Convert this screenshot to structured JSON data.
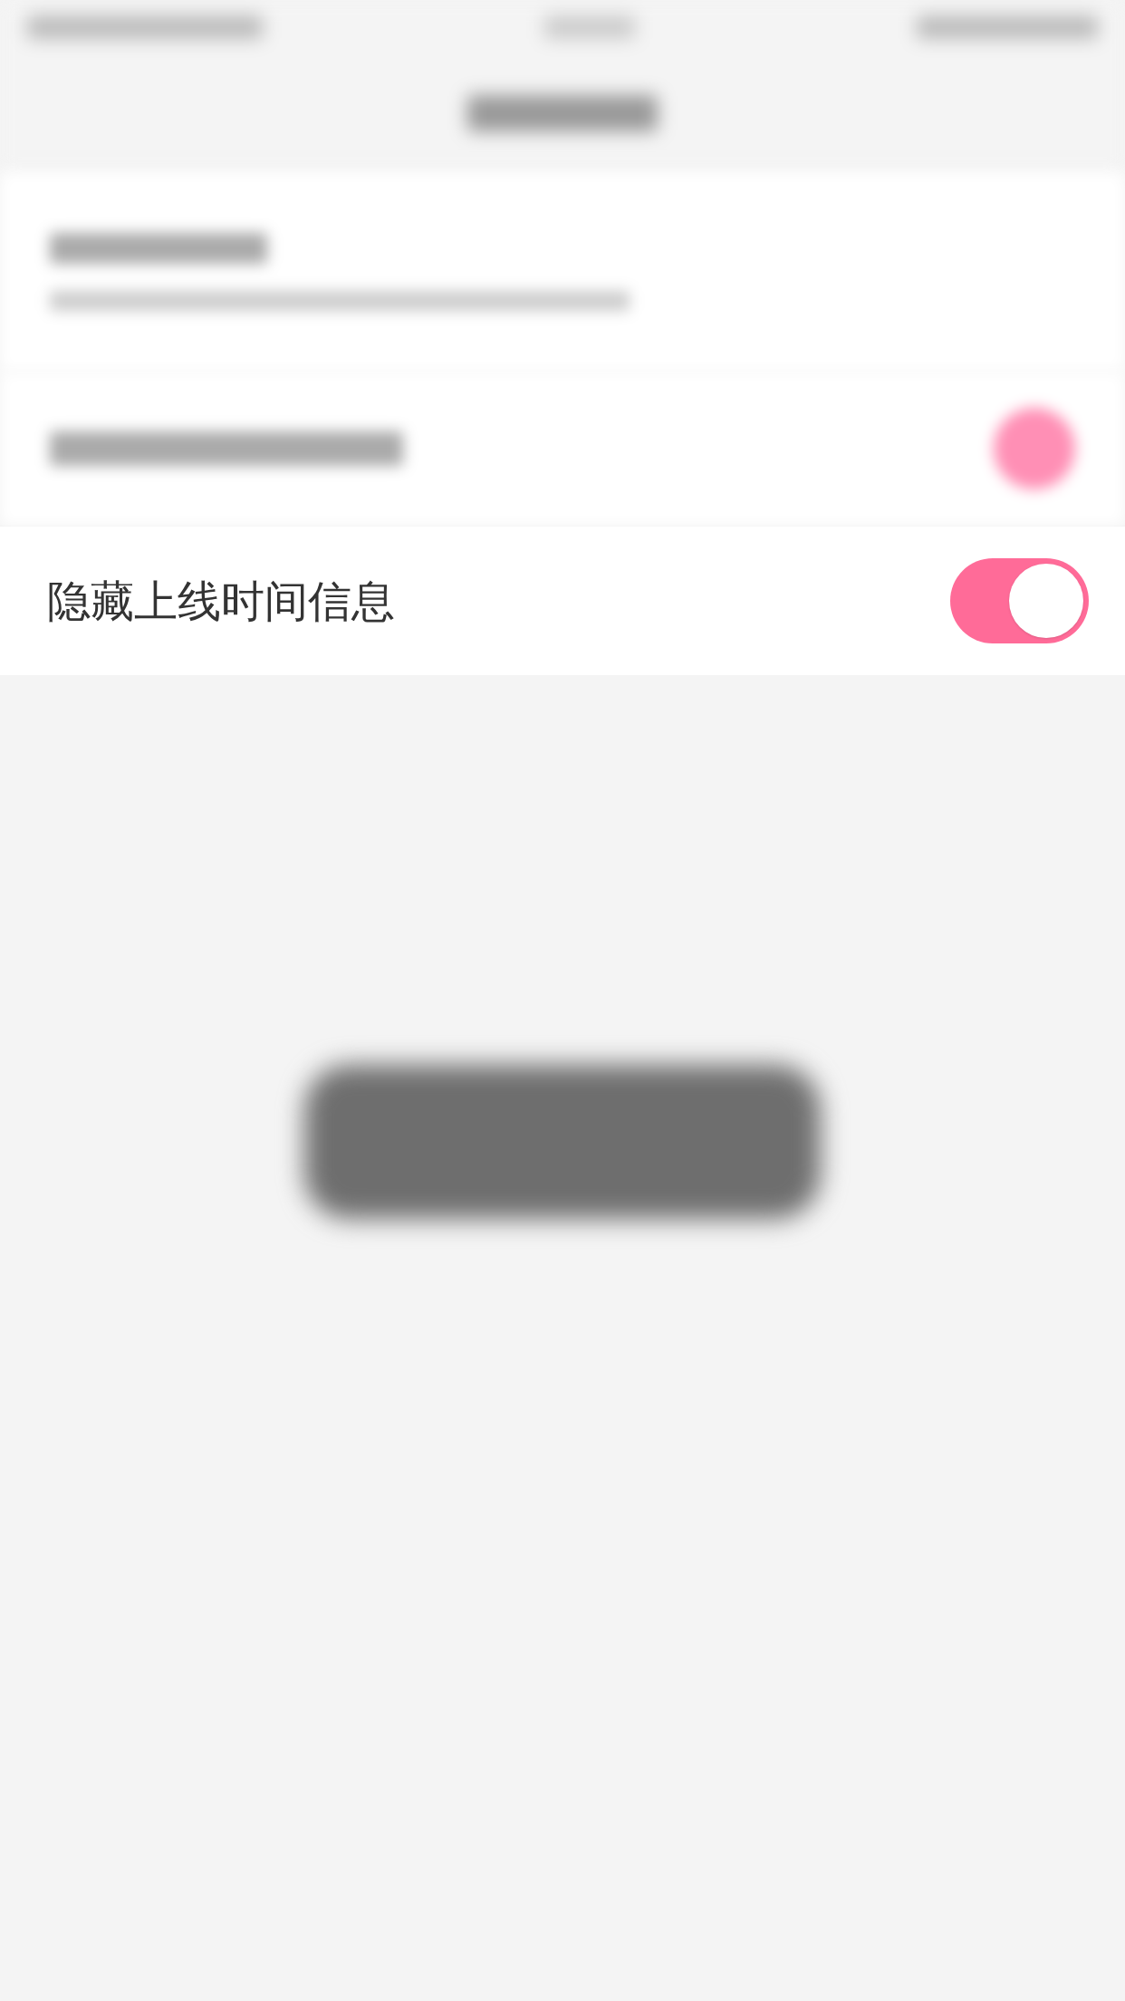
{
  "settings": [
    {
      "label": "隐藏上线时间信息",
      "kind": "toggle",
      "on": true
    }
  ]
}
